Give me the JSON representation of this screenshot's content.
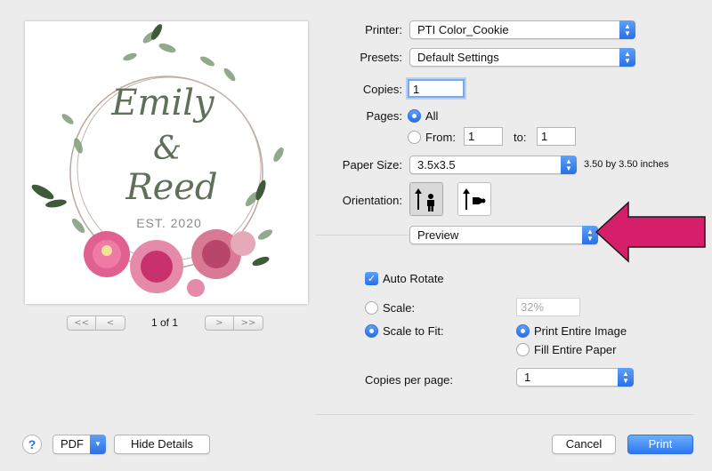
{
  "preview": {
    "name1": "Emily",
    "ampersand": "&",
    "name2": "Reed",
    "est": "EST. 2020",
    "first_btn": "<<",
    "prev_btn": "<",
    "next_btn": ">",
    "last_btn": ">>",
    "page_count": "1 of 1"
  },
  "printer": {
    "label": "Printer:",
    "value": "PTI Color_Cookie"
  },
  "presets": {
    "label": "Presets:",
    "value": "Default Settings"
  },
  "copies": {
    "label": "Copies:",
    "value": "1"
  },
  "pages": {
    "label": "Pages:",
    "all_label": "All",
    "from_label": "From:",
    "from_value": "1",
    "to_label": "to:",
    "to_value": "1"
  },
  "paper_size": {
    "label": "Paper Size:",
    "value": "3.5x3.5",
    "dimensions": "3.50 by 3.50 inches"
  },
  "orientation": {
    "label": "Orientation:"
  },
  "section": {
    "value": "Preview"
  },
  "auto_rotate": {
    "label": "Auto Rotate",
    "checked": true
  },
  "scale": {
    "label": "Scale:",
    "value": "32%"
  },
  "scale_to_fit": {
    "label": "Scale to Fit:",
    "print_entire_image": "Print Entire Image",
    "fill_entire_paper": "Fill Entire Paper"
  },
  "copies_per_page": {
    "label": "Copies per page:",
    "value": "1"
  },
  "footer": {
    "help": "?",
    "pdf": "PDF",
    "hide_details": "Hide Details",
    "cancel": "Cancel",
    "print": "Print"
  },
  "colors": {
    "accent": "#2a6fe6",
    "arrow": "#d61f6b",
    "script_text": "#5f6f5a"
  },
  "icons": {
    "portrait": "portrait-orientation-icon",
    "landscape": "landscape-orientation-icon",
    "popup": "chevron-updown-icon",
    "annotation": "pink-arrow-icon"
  }
}
